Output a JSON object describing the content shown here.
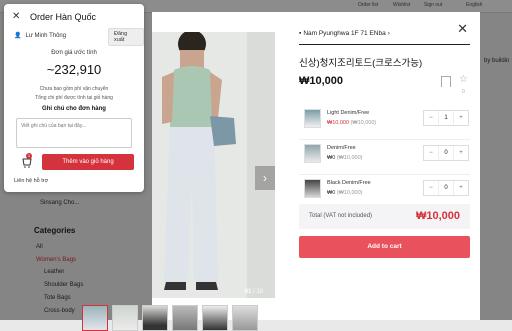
{
  "background": {
    "top_links": [
      "Order list",
      "Wishlist",
      "Sign out",
      "English"
    ],
    "seller_chip": "Sinsang Cho...",
    "categories_title": "Categories",
    "categories": [
      "All",
      "Women's Bags",
      "Leather",
      "Shoulder Bags",
      "Tote Bags",
      "Cross-body"
    ],
    "active_category": "Women's Bags",
    "right_text": "by buildin"
  },
  "popup": {
    "title": "Order Hàn Quốc",
    "user": "Lư Minh Thông",
    "logout": "Đăng xuất",
    "estimate_label": "Đơn giá ước tính",
    "estimate_value": "~232,910",
    "note_shipping": "Chưa bao gồm phí vận chuyển",
    "note_total": "Tổng chi phí được tính tại giỏ hàng",
    "notes_label": "Ghi chú cho đơn hàng",
    "notes_placeholder": "Viết ghi chú của bạn tại đây...",
    "cart_count": "1",
    "add_button": "Thêm vào giỏ hàng",
    "support": "Liên hệ hỗ trợ"
  },
  "modal": {
    "seller": "Nam Pyunghwa 1F 71 ENba",
    "title": "신상)청지조리토드(크로스가능)",
    "price": "₩10,000",
    "star_count": "0",
    "image_counter_current": "01",
    "image_counter_total": "/ 10",
    "variants": [
      {
        "name": "Light Denim/Free",
        "price": "₩10,000",
        "old": "(₩10,000)",
        "qty": "1"
      },
      {
        "name": "Denim/Free",
        "price": "₩0",
        "old": "(₩10,000)",
        "qty": "0"
      },
      {
        "name": "Black Denim/Free",
        "price": "₩0",
        "old": "(₩10,000)",
        "qty": "0"
      }
    ],
    "total_label": "Total (VAT not included)",
    "total_value": "₩10,000",
    "add_to_cart": "Add to cart"
  },
  "colors": {
    "accent": "#d4333d",
    "add_cart": "#e9525d"
  }
}
